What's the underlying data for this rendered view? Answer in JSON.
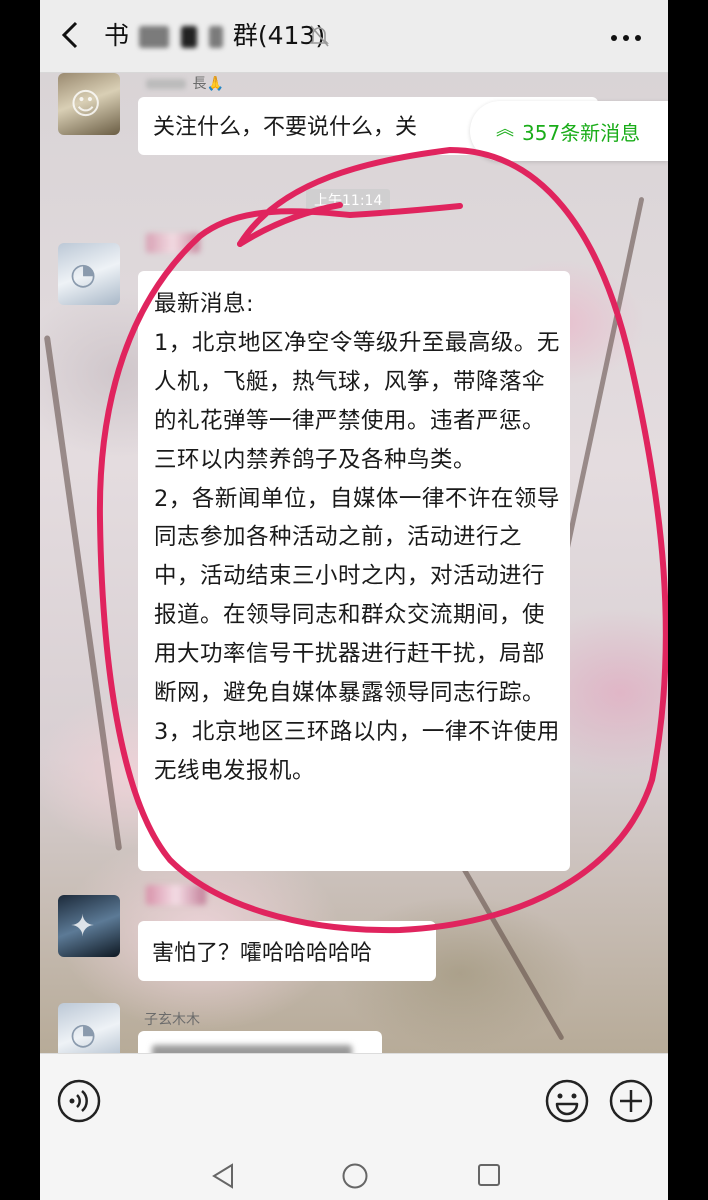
{
  "header": {
    "title_prefix": "书",
    "title_suffix": "群",
    "member_count": "(413)",
    "icons": [
      "back-arrow-icon",
      "mute-bell-icon",
      "more-icon"
    ]
  },
  "new_messages": {
    "label": "357条新消息",
    "icon": "double-chevron-up-icon"
  },
  "messages": [
    {
      "sender_visible": "長",
      "emoji": "🙏",
      "text": "关注什么，不要说什么，关"
    },
    {
      "timestamp": "上午11:14"
    },
    {
      "text": "最新消息:\n1，北京地区净空令等级升至最高级。无人机，飞艇，热气球，风筝，带降落伞的礼花弹等一律严禁使用。违者严惩。三环以内禁养鸽子及各种鸟类。\n2，各新闻单位，自媒体一律不许在领导同志参加各种活动之前，活动进行之中，活动结束三小时之内，对活动进行报道。在领导同志和群众交流期间，使用大功率信号干扰器进行赶干扰，局部断网，避免自媒体暴露领导同志行踪。\n3，北京地区三环路以内，一律不许使用无线电发报机。"
    },
    {
      "text": "害怕了？嚯哈哈哈哈哈"
    },
    {
      "sender": "子玄木木"
    }
  ],
  "input_bar": {
    "icons": [
      "voice-icon",
      "emoji-icon",
      "plus-icon"
    ]
  },
  "nav_bar": {
    "icons": [
      "nav-back-icon",
      "nav-home-icon",
      "nav-recent-icon"
    ]
  },
  "colors": {
    "accent_green": "#1aad19",
    "annotation_red": "#e0245e",
    "bubble": "#ffffff"
  }
}
